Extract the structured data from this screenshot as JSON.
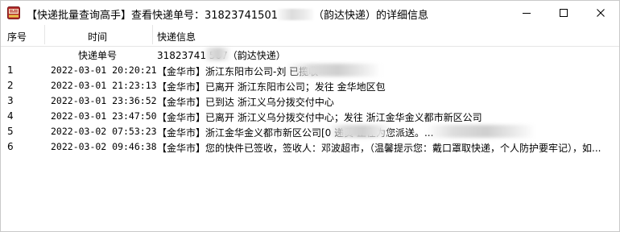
{
  "window": {
    "title_prefix": "【快递批量查询高手】查看快递单号：31823741501",
    "title_suffix": "（韵达快递）的详细信息"
  },
  "columns": {
    "no": "序号",
    "time": "时间",
    "info": "快递信息"
  },
  "subheader": {
    "time": "快递单号",
    "info": "31823741    567（韵达快递）"
  },
  "rows": [
    {
      "no": "1",
      "time": "2022-03-01 20:20:21",
      "info": "【金华市】浙江东阳市公司-刘                         已揽收"
    },
    {
      "no": "2",
      "time": "2022-03-01 21:23:13",
      "info": "【金华市】已离开 浙江东阳市公司；发往 金华地区包"
    },
    {
      "no": "3",
      "time": "2022-03-01 23:36:52",
      "info": "【金华市】已到达 浙江义乌分拨交付中心"
    },
    {
      "no": "4",
      "time": "2022-03-01 23:47:50",
      "info": "【金华市】已离开 浙江义乌分拨交付中心；发往 浙江金华金义都市新区公司"
    },
    {
      "no": "5",
      "time": "2022-03-02 07:53:23",
      "info": "【金华市】浙江金华金义都市新区公司[0                 递员                              正在为您派送。..."
    },
    {
      "no": "6",
      "time": "2022-03-02 09:46:38",
      "info": "【金华市】您的快件已签收，签收人：邓波超市，（温馨提示您：戴口罩取快递，个人防护要牢记），如..."
    }
  ]
}
